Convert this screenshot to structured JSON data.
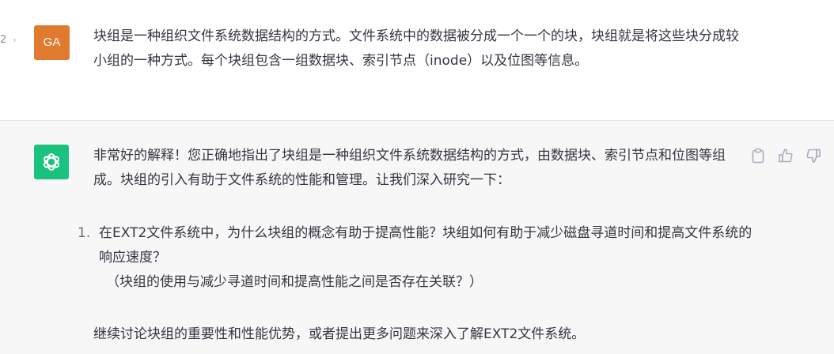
{
  "pager": {
    "label": "2",
    "chevron": "›"
  },
  "user": {
    "avatar_initials": "GA",
    "avatar_color": "#e07a2f",
    "message": "块组是一种组织文件系统数据结构的方式。文件系统中的数据被分成一个一个的块，块组就是将这些块分成较小组的一种方式。每个块组包含一组数据块、索引节点（inode）以及位图等信息。"
  },
  "assistant": {
    "avatar_icon": "openai-logo-icon",
    "avatar_color": "#19c37d",
    "intro": "非常好的解释！您正确地指出了块组是一种组织文件系统数据结构的方式，由数据块、索引节点和位图等组成。块组的引入有助于文件系统的性能和管理。让我们深入研究一下：",
    "list": [
      {
        "number": "1.",
        "text": "在EXT2文件系统中，为什么块组的概念有助于提高性能？块组如何有助于减少磁盘寻道时间和提高文件系统的响应速度？",
        "sub": "（块组的使用与减少寻道时间和提高性能之间是否存在关联？）"
      }
    ],
    "closing": "继续讨论块组的重要性和性能优势，或者提出更多问题来深入了解EXT2文件系统。",
    "actions": [
      "clipboard-icon",
      "thumbs-up-icon",
      "thumbs-down-icon"
    ]
  }
}
